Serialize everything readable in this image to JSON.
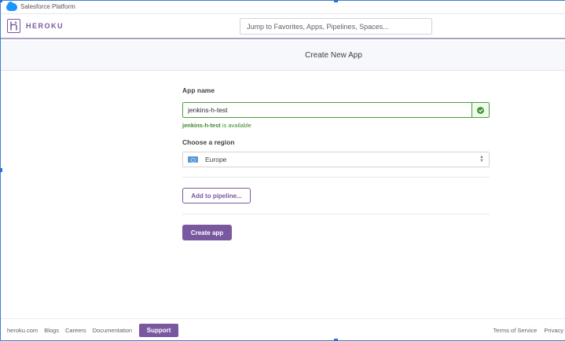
{
  "platform_bar": {
    "label": "Salesforce Platform",
    "icon": "salesforce-cloud-icon"
  },
  "header": {
    "brand": "HEROKU",
    "brand_color": "#79589f",
    "search_placeholder": "Jump to Favorites, Apps, Pipelines, Spaces..."
  },
  "page": {
    "title": "Create New App"
  },
  "form": {
    "app_name_label": "App name",
    "app_name_value": "jenkins-h-test",
    "availability_name": "jenkins-h-test",
    "availability_suffix": " is available",
    "availability_color": "#3d8a2a",
    "region_label": "Choose a region",
    "region_value": "Europe",
    "pipeline_button": "Add to pipeline...",
    "create_button": "Create app"
  },
  "footer": {
    "links": [
      "heroku.com",
      "Blogs",
      "Careers",
      "Documentation"
    ],
    "support_button": "Support",
    "right_links": [
      "Terms of Service",
      "Privacy"
    ]
  }
}
